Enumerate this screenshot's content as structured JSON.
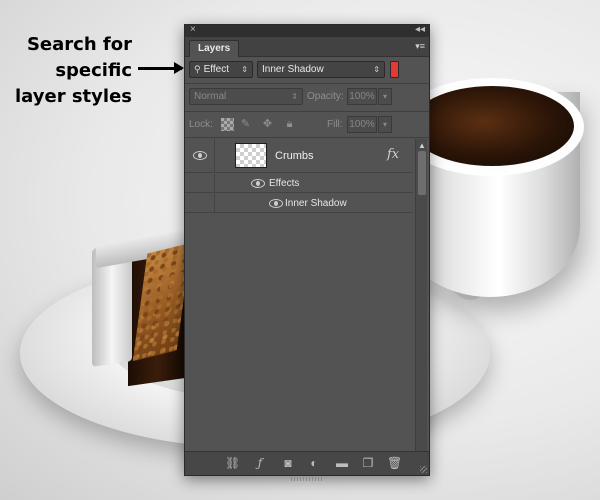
{
  "annotation": {
    "line1": "Search for",
    "line2": "specific",
    "line3": "layer styles"
  },
  "panel": {
    "close_glyph": "×",
    "collapse_glyph": "◂◂",
    "tab_label": "Layers",
    "menu_glyph": "▾≡",
    "filter": {
      "type_value": "Effect",
      "style_value": "Inner Shadow",
      "toggle_color": "#e23b33"
    },
    "blend": {
      "mode_value": "Normal",
      "opacity_label": "Opacity:",
      "opacity_value": "100%"
    },
    "lock": {
      "label": "Lock:",
      "fill_label": "Fill:",
      "fill_value": "100%"
    },
    "layers": [
      {
        "name": "Crumbs",
        "fx_label": "fx",
        "effects_label": "Effects",
        "effect_items": [
          "Inner Shadow"
        ]
      }
    ]
  },
  "colors": {
    "panel_bg": "#535353",
    "accent_red": "#e23b33"
  }
}
